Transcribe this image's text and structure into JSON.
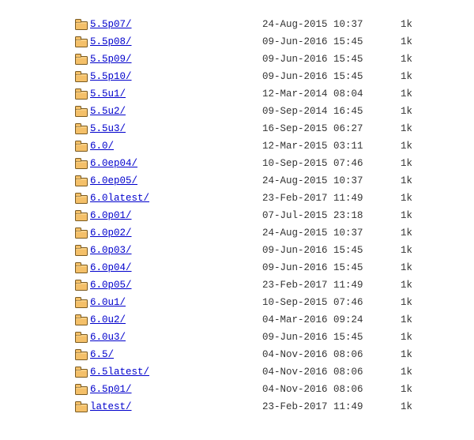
{
  "listing": {
    "entries": [
      {
        "name": "5.5p07/",
        "date": "24-Aug-2015 10:37",
        "size": "1k"
      },
      {
        "name": "5.5p08/",
        "date": "09-Jun-2016 15:45",
        "size": "1k"
      },
      {
        "name": "5.5p09/",
        "date": "09-Jun-2016 15:45",
        "size": "1k"
      },
      {
        "name": "5.5p10/",
        "date": "09-Jun-2016 15:45",
        "size": "1k"
      },
      {
        "name": "5.5u1/",
        "date": "12-Mar-2014 08:04",
        "size": "1k"
      },
      {
        "name": "5.5u2/",
        "date": "09-Sep-2014 16:45",
        "size": "1k"
      },
      {
        "name": "5.5u3/",
        "date": "16-Sep-2015 06:27",
        "size": "1k"
      },
      {
        "name": "6.0/",
        "date": "12-Mar-2015 03:11",
        "size": "1k"
      },
      {
        "name": "6.0ep04/",
        "date": "10-Sep-2015 07:46",
        "size": "1k"
      },
      {
        "name": "6.0ep05/",
        "date": "24-Aug-2015 10:37",
        "size": "1k"
      },
      {
        "name": "6.0latest/",
        "date": "23-Feb-2017 11:49",
        "size": "1k"
      },
      {
        "name": "6.0p01/",
        "date": "07-Jul-2015 23:18",
        "size": "1k"
      },
      {
        "name": "6.0p02/",
        "date": "24-Aug-2015 10:37",
        "size": "1k"
      },
      {
        "name": "6.0p03/",
        "date": "09-Jun-2016 15:45",
        "size": "1k"
      },
      {
        "name": "6.0p04/",
        "date": "09-Jun-2016 15:45",
        "size": "1k"
      },
      {
        "name": "6.0p05/",
        "date": "23-Feb-2017 11:49",
        "size": "1k"
      },
      {
        "name": "6.0u1/",
        "date": "10-Sep-2015 07:46",
        "size": "1k"
      },
      {
        "name": "6.0u2/",
        "date": "04-Mar-2016 09:24",
        "size": "1k"
      },
      {
        "name": "6.0u3/",
        "date": "09-Jun-2016 15:45",
        "size": "1k"
      },
      {
        "name": "6.5/",
        "date": "04-Nov-2016 08:06",
        "size": "1k"
      },
      {
        "name": "6.5latest/",
        "date": "04-Nov-2016 08:06",
        "size": "1k"
      },
      {
        "name": "6.5p01/",
        "date": "04-Nov-2016 08:06",
        "size": "1k"
      },
      {
        "name": "latest/",
        "date": "23-Feb-2017 11:49",
        "size": "1k"
      }
    ]
  }
}
